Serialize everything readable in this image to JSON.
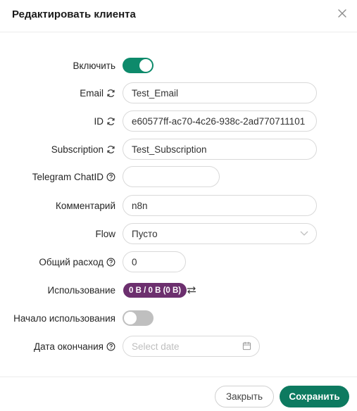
{
  "dialog": {
    "title": "Редактировать клиента"
  },
  "fields": {
    "enable": {
      "label": "Включить",
      "checked": true
    },
    "email": {
      "label": "Email",
      "value": "Test_Email"
    },
    "id": {
      "label": "ID",
      "value": "e60577ff-ac70-4c26-938c-2ad770711101"
    },
    "subscription": {
      "label": "Subscription",
      "value": "Test_Subscription"
    },
    "telegram_chat_id": {
      "label": "Telegram ChatID",
      "value": ""
    },
    "comment": {
      "label": "Комментарий",
      "value": "n8n"
    },
    "flow": {
      "label": "Flow",
      "value": "Пусто"
    },
    "total_usage": {
      "label": "Общий расход",
      "value": "0"
    },
    "usage": {
      "label": "Использование",
      "badge": "0 B / 0 B (0 B)"
    },
    "start_on_use": {
      "label": "Начало использования",
      "checked": false
    },
    "expiry_date": {
      "label": "Дата окончания",
      "placeholder": "Select date"
    }
  },
  "footer": {
    "close_label": "Закрыть",
    "save_label": "Сохранить"
  },
  "colors": {
    "accent": "#0d8a6b",
    "save_button": "#0d7a60",
    "usage_badge": "#6c2f6e",
    "toggle_off": "#bfbfbf"
  },
  "icons": {
    "close": "close-icon",
    "regenerate": "refresh-icon",
    "help": "question-circle-icon",
    "select": "chevron-down-icon",
    "calendar": "calendar-icon",
    "reset": "swap-arrows-icon"
  }
}
